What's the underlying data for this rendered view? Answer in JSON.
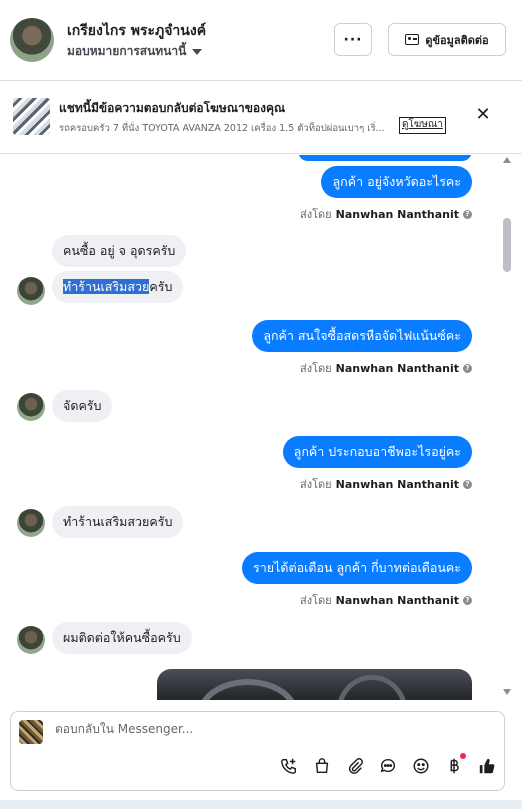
{
  "header": {
    "contact_name": "เกรียงไกร พระภูจำนงค์",
    "assign_label": "มอบหมายการสนทนานี้",
    "more_label": "···",
    "contact_info_label": "ดูข้อมูลติดต่อ"
  },
  "ad_banner": {
    "title": "แชทนี้มีข้อความตอบกลับต่อโฆษณาของคุณ",
    "description": "รถครอบครัว 7 ที่นั่ง TOYOTA AVANZA 2012 เครื่อง 1.5 ตัวท็อปผ่อนเบาๆ เริ่...",
    "link_label": "ดูโฆษณา",
    "close_label": "✕"
  },
  "messages": [
    {
      "dir": "out",
      "text": "ลูกค้า อยู่จังหวัดอะไรคะ"
    },
    {
      "dir": "meta",
      "sent_by_label": "ส่งโดย",
      "sender": "Nanwhan Nanthanit"
    },
    {
      "dir": "in",
      "text": "คนซื้อ อยู่ จ อุดรครับ"
    },
    {
      "dir": "in",
      "text_highlight": "ทำร้านเสริมสวย",
      "text_rest": "ครับ"
    },
    {
      "dir": "out",
      "text": "ลูกค้า สนใจซื้อสดรหือจัดไฟแน้นซ์คะ"
    },
    {
      "dir": "meta",
      "sent_by_label": "ส่งโดย",
      "sender": "Nanwhan Nanthanit"
    },
    {
      "dir": "in",
      "text": "จัดครับ"
    },
    {
      "dir": "out",
      "text": "ลูกค้า ประกอบอาชีพอะไรอยู่คะ"
    },
    {
      "dir": "meta",
      "sent_by_label": "ส่งโดย",
      "sender": "Nanwhan Nanthanit"
    },
    {
      "dir": "in",
      "text": "ทำร้านเสริมสวยครับ"
    },
    {
      "dir": "out",
      "text": "รายได้ต่อเดือน  ลูกค้า กี่บาทต่อเดือนคะ"
    },
    {
      "dir": "meta",
      "sent_by_label": "ส่งโดย",
      "sender": "Nanwhan Nanthanit"
    },
    {
      "dir": "in",
      "text": "ผมติดต่อให้คนซื้อครับ"
    }
  ],
  "composer": {
    "placeholder": "ตอบกลับใน Messenger..."
  },
  "icons": {
    "toolbar": [
      "add-call-icon",
      "bag-icon",
      "paperclip-icon",
      "chat-bubble-icon",
      "emoji-icon",
      "baht-icon",
      "thumbs-up-icon"
    ]
  },
  "colors": {
    "outgoing_bubble": "#0a7cff",
    "incoming_bubble": "#eef0f3",
    "notification_dot": "#f02849"
  }
}
